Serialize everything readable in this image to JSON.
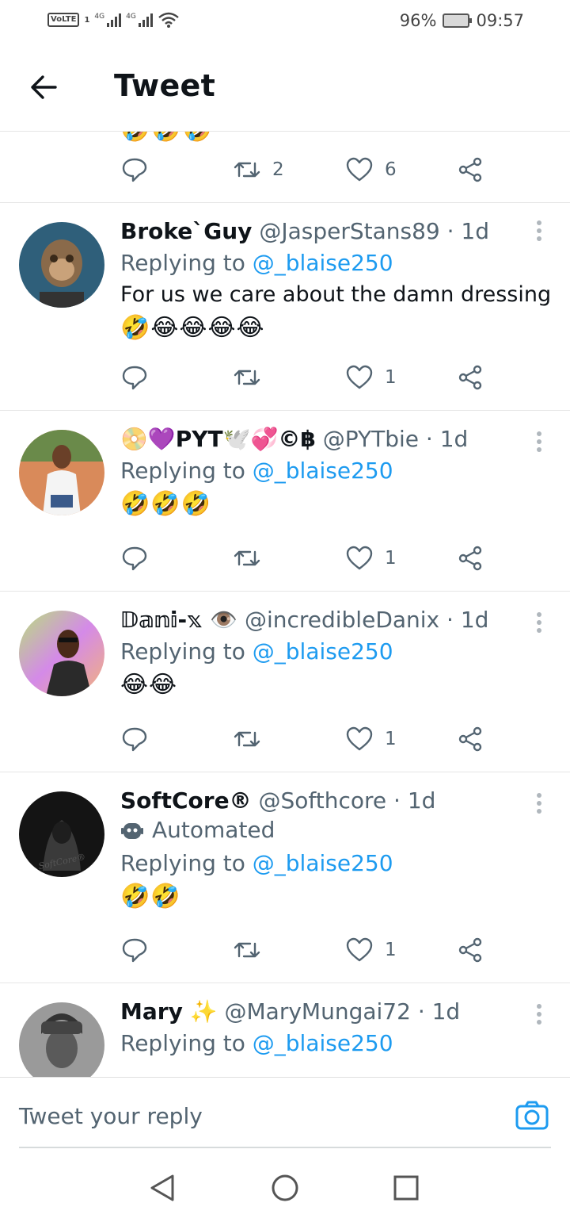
{
  "status_bar": {
    "volte": "VoLTE",
    "sim1": "1",
    "net1": "4G",
    "net2": "4G",
    "battery_pct": "96%",
    "time": "09:57",
    "battery_level": 0.96
  },
  "header": {
    "title": "Tweet"
  },
  "partial_tweet": {
    "emojis": "🤣🤣🤣",
    "retweets": "2",
    "likes": "6"
  },
  "tweets": [
    {
      "name": "Broke`Guy",
      "handle": "@JasperStans89",
      "time": "· 1d",
      "replying_prefix": "Replying to",
      "mention": "@_blaise250",
      "text": "For us we care about the damn dressing",
      "emojis": "🤣😂😂😂😂",
      "likes": "1",
      "avatar_color": "#2f5f7a"
    },
    {
      "name": "📀💜PYT🕊️💞©฿",
      "handle": "@PYTbie",
      "time": "· 1d",
      "replying_prefix": "Replying to",
      "mention": "@_blaise250",
      "emojis": "🤣🤣🤣",
      "likes": "1",
      "avatar_color": "#c9704a"
    },
    {
      "name": "𝔻𝕒𝕟𝕚-𝕩 👁️",
      "handle": "@incredibleDanix",
      "time": "· 1d",
      "replying_prefix": "Replying to",
      "mention": "@_blaise250",
      "emojis": "😂😂",
      "likes": "1",
      "avatar_color": "#c58be0"
    },
    {
      "name": "SoftCore®",
      "handle": "@Softhcore",
      "time": "· 1d",
      "automated": "Automated",
      "replying_prefix": "Replying to",
      "mention": "@_blaise250",
      "emojis": "🤣🤣",
      "likes": "1",
      "avatar_color": "#1a1a1a"
    },
    {
      "name": "Mary",
      "name_emoji": "✨",
      "handle": "@MaryMungai72",
      "time": "· 1d",
      "replying_prefix": "Replying to",
      "mention": "@_blaise250",
      "avatar_color": "#8a8a8a"
    }
  ],
  "reply_bar": {
    "placeholder": "Tweet your reply"
  },
  "colors": {
    "accent": "#1d9bf0",
    "muted": "#536471",
    "text": "#0f1419"
  }
}
